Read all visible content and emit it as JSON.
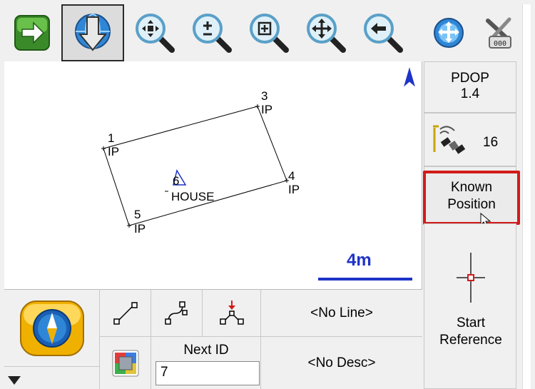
{
  "toolbar": {
    "items": [
      {
        "icon": "green-arrow-right-icon",
        "active": false
      },
      {
        "icon": "globe-down-arrow-icon",
        "active": true
      },
      {
        "icon": "zoom-extents-icon",
        "active": false
      },
      {
        "icon": "zoom-in-out-icon",
        "active": false
      },
      {
        "icon": "zoom-window-icon",
        "active": false
      },
      {
        "icon": "pan-icon",
        "active": false
      },
      {
        "icon": "zoom-previous-icon",
        "active": false
      },
      {
        "icon": "globe-move-icon",
        "active": false
      },
      {
        "icon": "survey-tools-icon",
        "active": false
      }
    ]
  },
  "map": {
    "points": [
      {
        "id": "1",
        "desc": "IP"
      },
      {
        "id": "3",
        "desc": "IP"
      },
      {
        "id": "4",
        "desc": "IP"
      },
      {
        "id": "5",
        "desc": "IP"
      },
      {
        "id": "6",
        "desc": "HOUSE"
      }
    ],
    "scale_label": "4m",
    "north_arrow": "north-arrow-icon",
    "colors": {
      "scale": "#1d33c8",
      "north": "#1d33c8"
    }
  },
  "status": {
    "pdop_label": "PDOP",
    "pdop_value": "1.4",
    "satellite_count": "16",
    "known_position_line1": "Known",
    "known_position_line2": "Position",
    "start_reference_line1": "Start",
    "start_reference_line2": "Reference",
    "highlight_color": "#d21a1a"
  },
  "bottom": {
    "next_id_label": "Next ID",
    "next_id_value": "7",
    "line_value": "<No Line>",
    "desc_value": "<No Desc>"
  }
}
